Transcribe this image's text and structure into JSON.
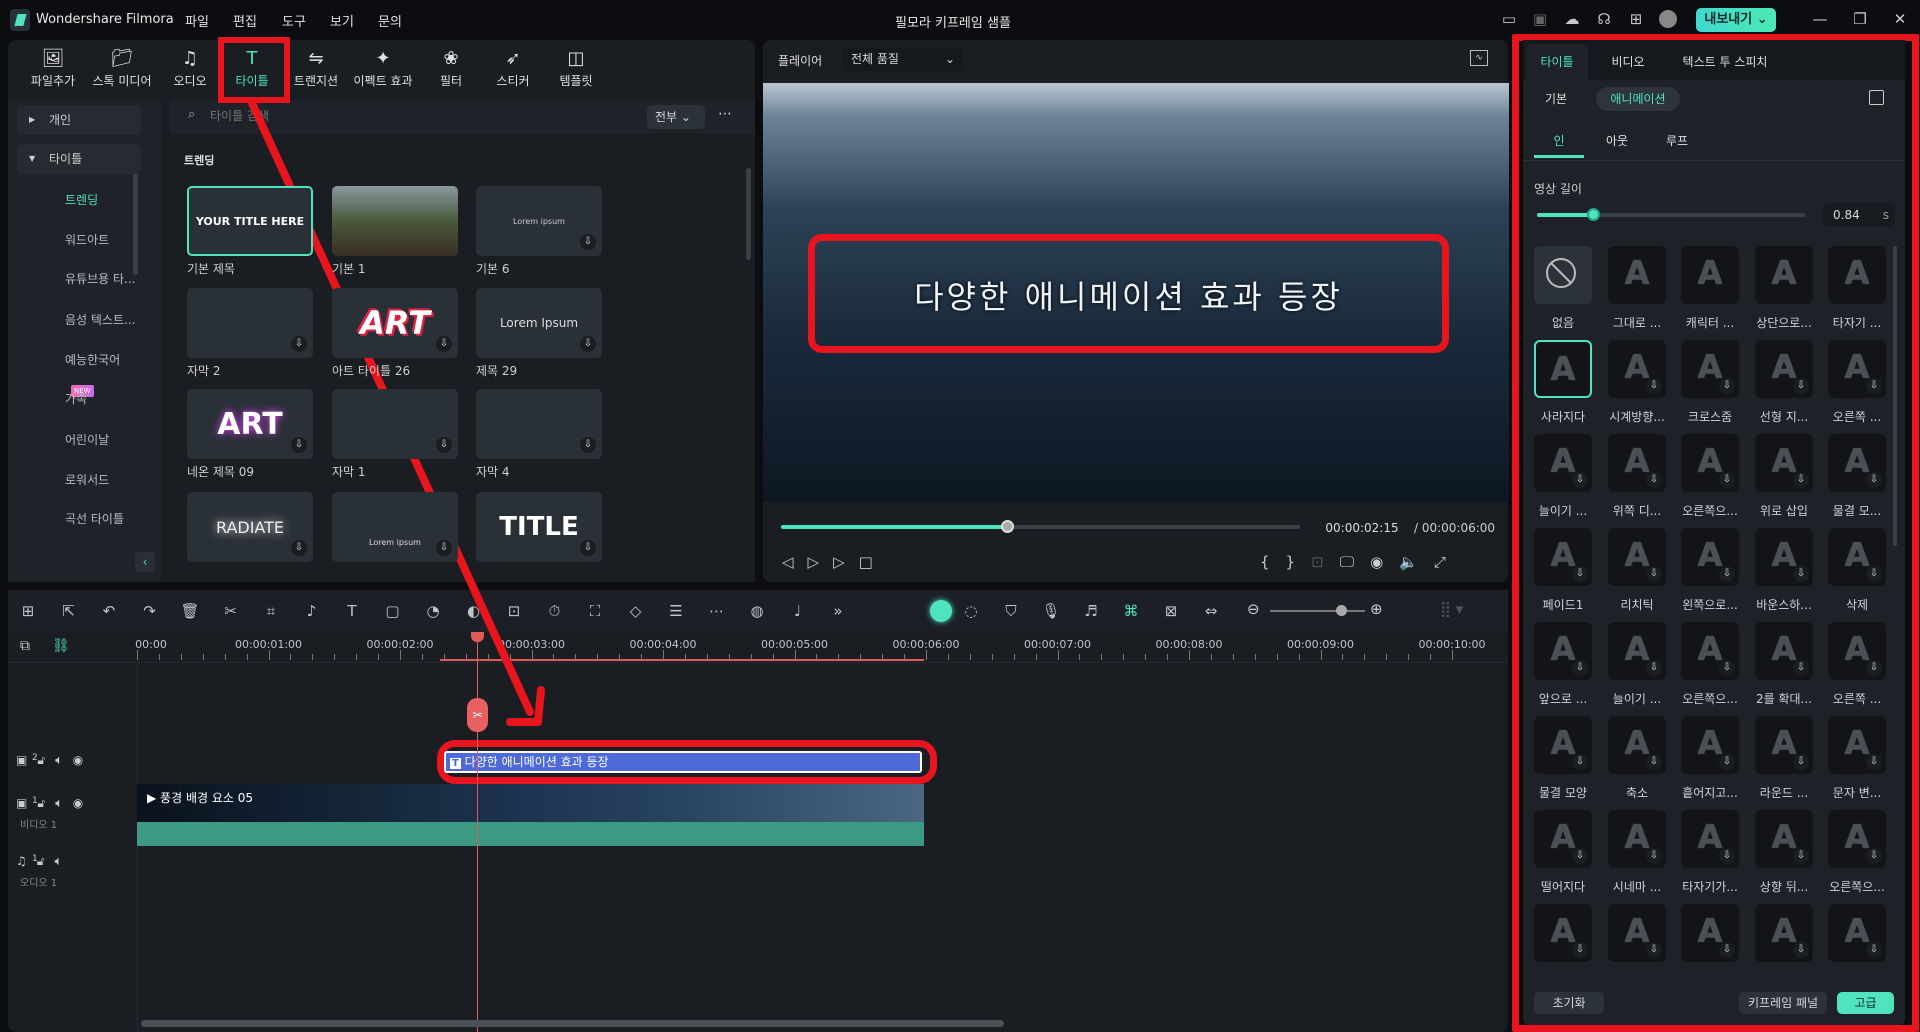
{
  "app": {
    "name": "Wondershare Filmora",
    "window_title": "필모라 키프레임 샘플",
    "export_label": "내보내기",
    "menu": [
      "파일",
      "편집",
      "도구",
      "보기",
      "문의"
    ]
  },
  "media_toolbar": [
    {
      "label": "파일추가",
      "icon": "import-icon"
    },
    {
      "label": "스톡 미디어",
      "icon": "stock-media-icon"
    },
    {
      "label": "오디오",
      "icon": "music-note-icon"
    },
    {
      "label": "타이틀",
      "icon": "title-t-icon",
      "active": true
    },
    {
      "label": "트랜지션",
      "icon": "transition-icon"
    },
    {
      "label": "이펙트 효과",
      "icon": "effects-icon"
    },
    {
      "label": "필터",
      "icon": "filter-icon"
    },
    {
      "label": "스티커",
      "icon": "sticker-icon"
    },
    {
      "label": "템플릿",
      "icon": "template-icon"
    }
  ],
  "sidebar": [
    {
      "label": "개인",
      "group": true
    },
    {
      "label": "타이틀",
      "group": true
    },
    {
      "label": "트렌딩",
      "active": true
    },
    {
      "label": "워드아트"
    },
    {
      "label": "유튜브용 타..."
    },
    {
      "label": "음성 텍스트..."
    },
    {
      "label": "예능한국어",
      "badge": "NEW"
    },
    {
      "label": "가족"
    },
    {
      "label": "어린이날"
    },
    {
      "label": "로워서드"
    },
    {
      "label": "곡선 타이틀"
    }
  ],
  "search": {
    "placeholder": "타이틀 검색",
    "filter": "전부"
  },
  "grid": {
    "section": "트렌딩",
    "cards": [
      {
        "label": "기본 제목",
        "thumb": "YOUR TITLE HERE",
        "selected": true
      },
      {
        "label": "기본 1",
        "thumb": ""
      },
      {
        "label": "기본 6",
        "thumb": "Lorem ipsum"
      },
      {
        "label": "자막 2",
        "thumb": ""
      },
      {
        "label": "아트 타이틀 26",
        "thumb": "ART"
      },
      {
        "label": "제목 29",
        "thumb": "Lorem Ipsum"
      },
      {
        "label": "네온 제목 09",
        "thumb": "ART"
      },
      {
        "label": "자막 1",
        "thumb": ""
      },
      {
        "label": "자막 4",
        "thumb": ""
      },
      {
        "label": "",
        "thumb": "RADIATE"
      },
      {
        "label": "",
        "thumb": "Lorem ipsum"
      },
      {
        "label": "",
        "thumb": "TITLE"
      }
    ]
  },
  "player": {
    "label": "플레이어",
    "quality": "전체 품질",
    "overlay_text": "다양한 애니메이션 효과 등장",
    "current_time": "00:00:02:15",
    "total_time": "/ 00:00:06:00",
    "progress": 0.435
  },
  "timeline": {
    "ruler": [
      "00:00",
      "00:00:01:00",
      "00:00:02:00",
      "00:00:03:00",
      "00:00:04:00",
      "00:00:05:00",
      "00:00:06:00",
      "00:00:07:00",
      "00:00:08:00",
      "00:00:09:00",
      "00:00:10:00"
    ],
    "title_clip": "다양한 애니메이션 효과 등장",
    "video_clip": "풍경 배경 요소 05",
    "video_track": "비디오 1",
    "audio_track": "오디오 1",
    "track2_num": "2",
    "track1_num": "1",
    "audio_num": "1",
    "zoom_level": 0.75
  },
  "right_panel": {
    "tabs": [
      "타이틀",
      "비디오",
      "텍스트 투 스피치"
    ],
    "subtabs": [
      "기본",
      "애니메이션"
    ],
    "anim_tabs": [
      "인",
      "아웃",
      "루프"
    ],
    "duration_label": "영상 길이",
    "duration_value": "0.84",
    "duration_unit": "s",
    "duration_fraction": 0.21,
    "presets": [
      "없음",
      "그대로 ...",
      "캐릭터 ...",
      "상단으로...",
      "타자기 ...",
      "사라지다",
      "시계방향...",
      "크로스줌",
      "선형 지...",
      "오른쪽 ...",
      "늘이기 ...",
      "위쪽 디...",
      "오른쪽으...",
      "위로 삽입",
      "물결 모...",
      "페이드1",
      "리치틱",
      "왼쪽으로...",
      "바운스하...",
      "삭제",
      "앞으로 ...",
      "늘이기 ...",
      "오른쪽으...",
      "2를 확대...",
      "오른쪽 ...",
      "물결 모양",
      "축소",
      "흩어지고...",
      "라운드 ...",
      "문자 변...",
      "떨어지다",
      "시네마 ...",
      "타자기가...",
      "상향 뒤...",
      "오른쪽으...",
      "",
      "",
      "",
      "",
      ""
    ],
    "selected_preset": "사라지다",
    "reset": "초기화",
    "keyframe_panel": "키프레임 패널",
    "advanced": "고급"
  },
  "colors": {
    "accent": "#4fe3c0",
    "annotation": "#e8141e",
    "title_clip": "#4e6ad8",
    "audio_wave": "#3d9a82"
  }
}
